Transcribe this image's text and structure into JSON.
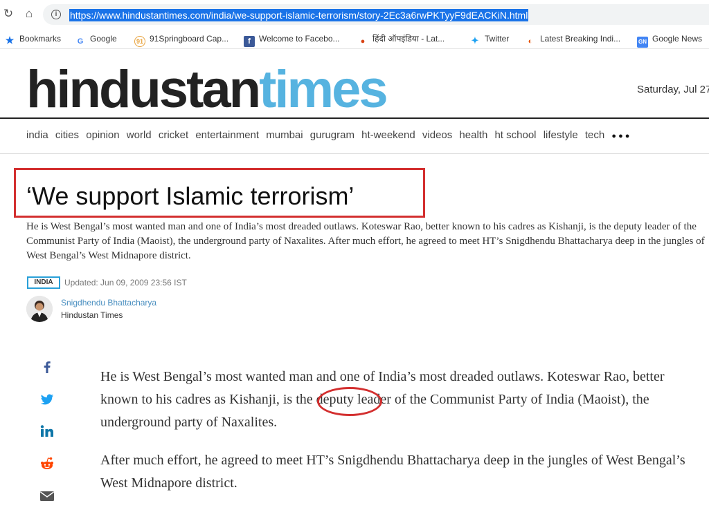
{
  "browser": {
    "url": "https://www.hindustantimes.com/india/we-support-islamic-terrorism/story-2Ec3a6rwPKTyyF9dEACKiN.html",
    "bookmarks": [
      {
        "label": "Bookmarks",
        "icon": "star-icon"
      },
      {
        "label": "Google",
        "icon": "google-icon"
      },
      {
        "label": "91Springboard Cap...",
        "icon": "springboard-icon"
      },
      {
        "label": "Welcome to Facebo...",
        "icon": "facebook-icon"
      },
      {
        "label": "हिंदी ऑपइंडिया - Lat...",
        "icon": "opindia-icon"
      },
      {
        "label": "Twitter",
        "icon": "twitter-icon"
      },
      {
        "label": "Latest Breaking Indi...",
        "icon": "news-icon"
      },
      {
        "label": "Google News",
        "icon": "google-news-icon"
      }
    ]
  },
  "site": {
    "logo_part1": "hindustan",
    "logo_part2": "times",
    "date": "Saturday, Jul 27",
    "nav": [
      "india",
      "cities",
      "opinion",
      "world",
      "cricket",
      "entertainment",
      "mumbai",
      "gurugram",
      "ht-weekend",
      "videos",
      "health",
      "ht school",
      "lifestyle",
      "tech"
    ],
    "more": "●●●"
  },
  "article": {
    "headline": "‘We support Islamic terrorism’",
    "summary": "He is West Bengal’s most wanted man and one of India’s most dreaded outlaws. Koteswar Rao, better known to his cadres as Kishanji, is the deputy leader of the Communist Party of India (Maoist), the underground party of Naxalites. After much effort, he agreed to meet HT’s Snigdhendu Bhattacharya deep in the jungles of West Bengal’s West Midnapore district.",
    "tag": "INDIA",
    "updated": "Updated: Jun 09, 2009 23:56 IST",
    "author": "Snigdhendu Bhattacharya",
    "publication": "Hindustan Times",
    "paragraphs": [
      "He is West Bengal’s most wanted man and one of India’s most dreaded outlaws. Koteswar Rao, better known to his cadres as Kishanji, is the deputy leader of the Communist Party of India (Maoist), the underground party of Naxalites.",
      "After much effort, he agreed to meet HT’s Snigdhendu Bhattacharya deep in the jungles of West Bengal’s West Midnapore district."
    ]
  },
  "colors": {
    "accent": "#56b3e0",
    "annotation": "#d32f2f",
    "selection": "#1a73e8"
  }
}
